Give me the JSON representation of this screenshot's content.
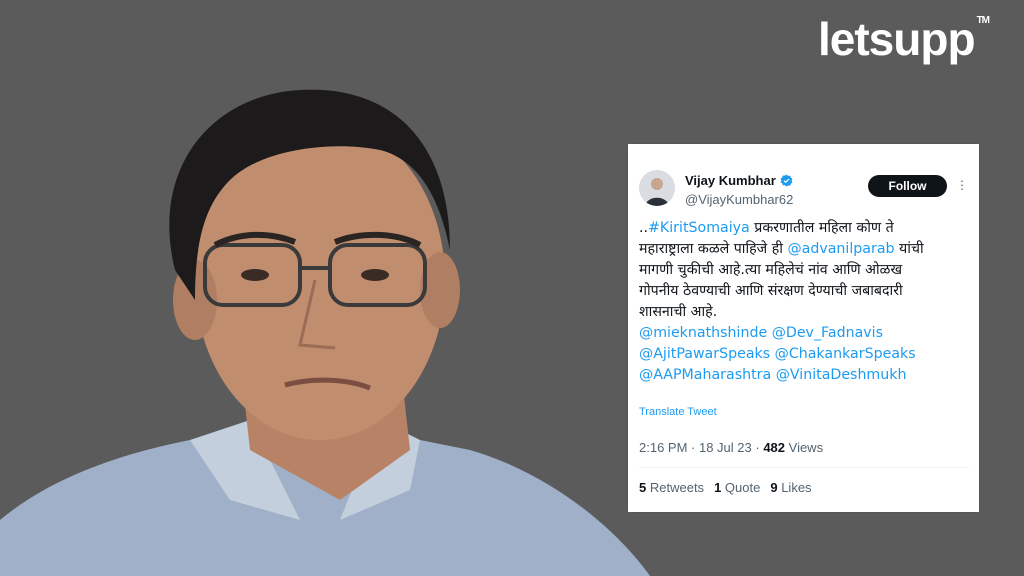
{
  "logo": {
    "text": "letsupp",
    "tm": "TM"
  },
  "tweet": {
    "author_name": "Vijay Kumbhar",
    "author_handle": "@VijayKumbhar62",
    "follow_label": "Follow",
    "more_icon": "⋮",
    "line1_prefix": "..",
    "line1_hashtag": "#KiritSomaiya",
    "line1_rest": " प्रकरणातील महिला कोण ते",
    "line2_text": "महाराष्ट्राला कळले पाहिजे ही ",
    "line2_mention": "@advanilparab",
    "line3_pre": " यांची",
    "line3_text": "मागणी चुकीची आहे.त्या महिलेचं नांव आणि ओळख",
    "line4_text": "गोपनीय ठेवण्याची आणि संरक्षण देण्याची जबाबदारी",
    "line5_text": "शासनाची आहे.",
    "mentions": {
      "m1": "@mieknathshinde",
      "m2": "@Dev_Fadnavis",
      "m3": "@AjitPawarSpeaks",
      "m4": "@ChakankarSpeaks",
      "m5": "@AAPMaharashtra",
      "m6": "@VinitaDeshmukh"
    },
    "translate_label": "Translate Tweet",
    "time": "2:16 PM",
    "dot": " · ",
    "date": "18 Jul 23",
    "dot2": " · ",
    "views_count": "482",
    "views_label": " Views",
    "retweets_count": "5",
    "retweets_label": "Retweets",
    "quotes_count": "1",
    "quotes_label": "Quote",
    "likes_count": "9",
    "likes_label": "Likes"
  },
  "colors": {
    "background": "#5b5b5b",
    "link": "#1d9bf0",
    "verified": "#1d9bf0",
    "text": "#0f1419",
    "muted": "#536471"
  }
}
